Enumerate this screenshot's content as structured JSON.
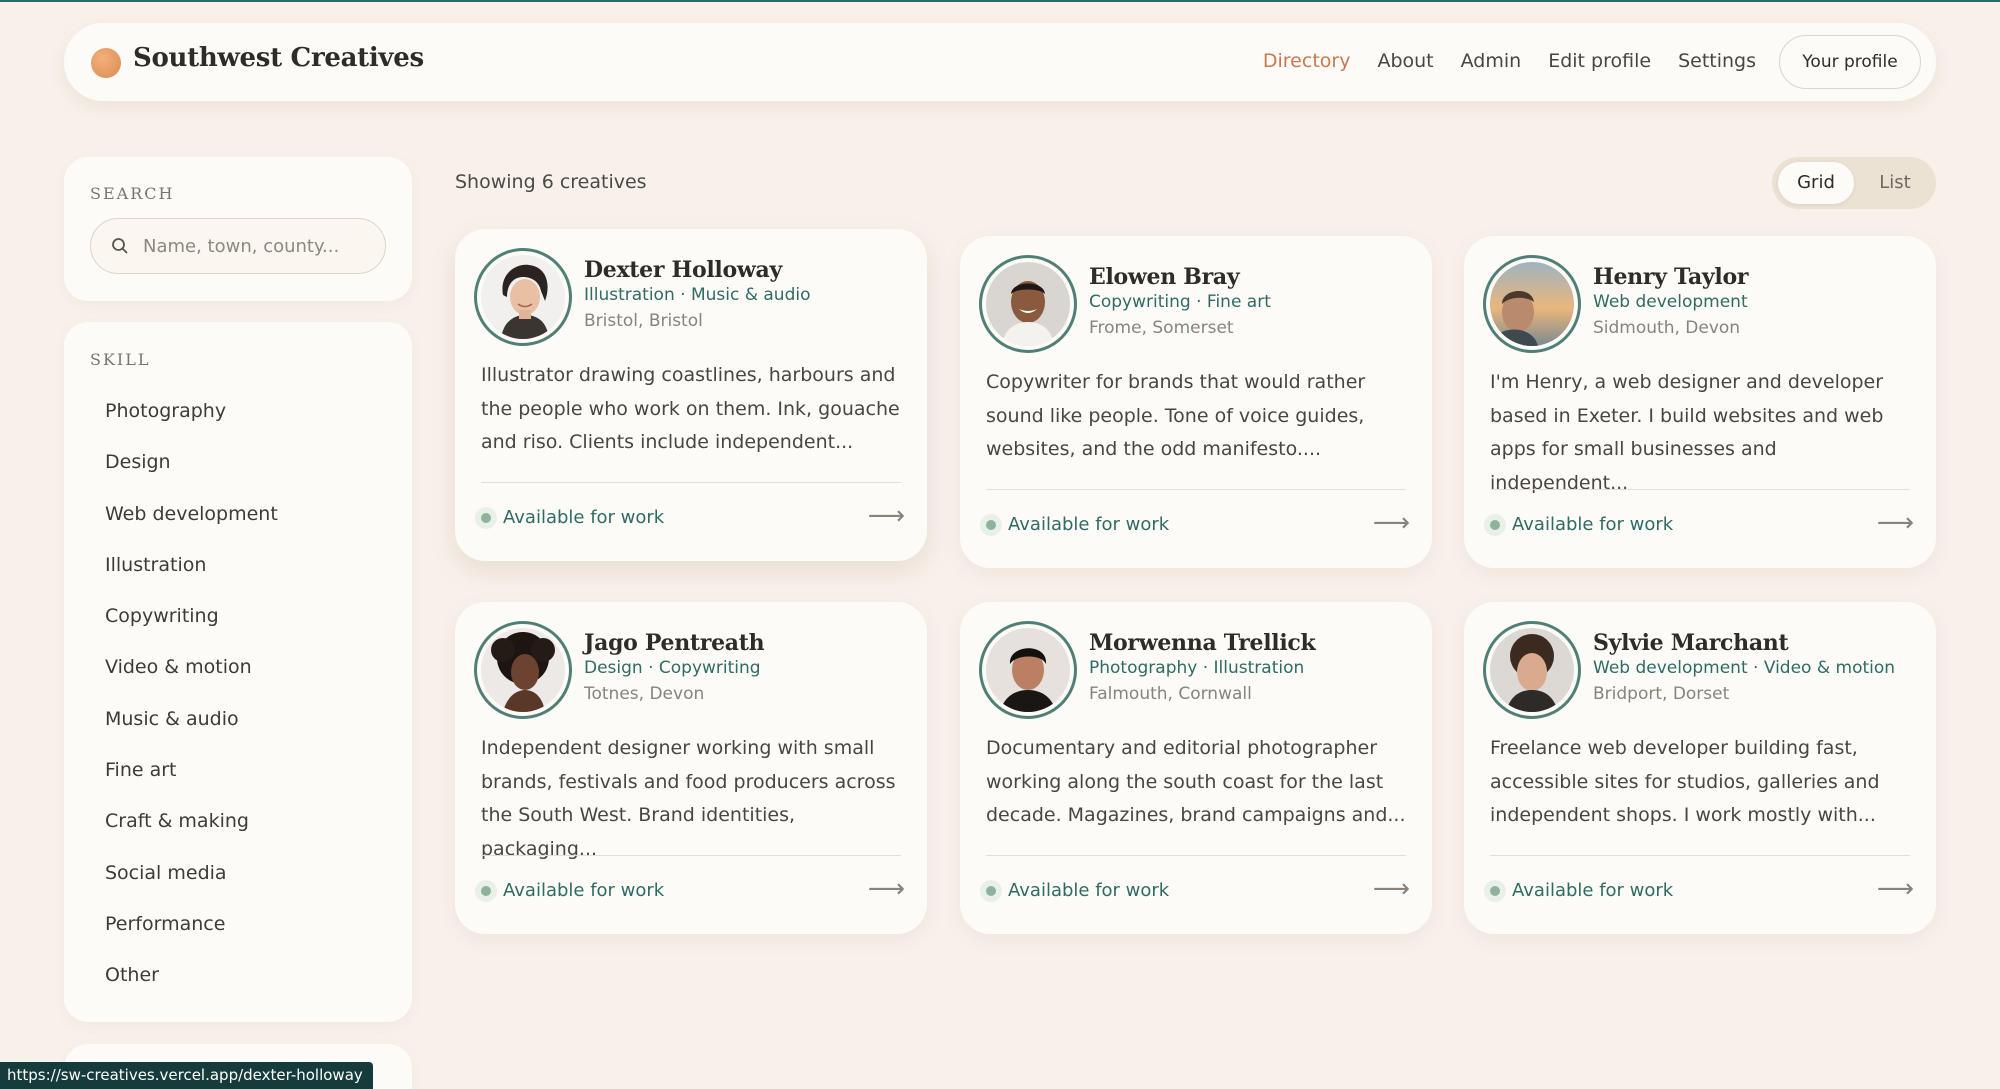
{
  "app": {
    "brand": "Southwest Creatives",
    "accent": "#c9794f",
    "teal": "#2f6b64"
  },
  "nav": {
    "items": [
      "Directory",
      "About",
      "Admin",
      "Edit profile",
      "Settings"
    ],
    "active": "Directory",
    "profile_button": "Your profile"
  },
  "search": {
    "title": "SEARCH",
    "placeholder": "Name, town, county..."
  },
  "skill_filter": {
    "title": "SKILL",
    "items": [
      "Photography",
      "Design",
      "Web development",
      "Illustration",
      "Copywriting",
      "Video & motion",
      "Music & audio",
      "Fine art",
      "Craft & making",
      "Social media",
      "Performance",
      "Other"
    ]
  },
  "results": {
    "count_label": "Showing 6 creatives",
    "view_toggle": {
      "grid": "Grid",
      "list": "List",
      "selected": "Grid"
    }
  },
  "creatives": [
    {
      "name": "Dexter Holloway",
      "skills": "Illustration · Music & audio",
      "location": "Bristol, Bristol",
      "bio": "Illustrator drawing coastlines, harbours and the people who work on them. Ink, gouache and riso. Clients include independent...",
      "status": "Available for work",
      "avatar": "woman-smiling-portrait"
    },
    {
      "name": "Elowen Bray",
      "skills": "Copywriting · Fine art",
      "location": "Frome, Somerset",
      "bio": "Copywriter for brands that would rather sound like people. Tone of voice guides, websites, and the odd manifesto....",
      "status": "Available for work",
      "avatar": "man-smiling-portrait"
    },
    {
      "name": "Henry Taylor",
      "skills": "Web development",
      "location": "Sidmouth, Devon",
      "bio": "I'm Henry, a web designer and developer based in Exeter. I build websites and web apps for small businesses and independent...",
      "status": "Available for work",
      "avatar": "man-sunset-portrait"
    },
    {
      "name": "Jago Pentreath",
      "skills": "Design · Copywriting",
      "location": "Totnes, Devon",
      "bio": "Independent designer working with small brands, festivals and food producers across the South West. Brand identities, packaging...",
      "status": "Available for work",
      "avatar": "woman-curly-hair-portrait"
    },
    {
      "name": "Morwenna Trellick",
      "skills": "Photography · Illustration",
      "location": "Falmouth, Cornwall",
      "bio": "Documentary and editorial photographer working along the south coast for the last decade. Magazines, brand campaigns and...",
      "status": "Available for work",
      "avatar": "young-man-portrait"
    },
    {
      "name": "Sylvie Marchant",
      "skills": "Web development · Video & motion",
      "location": "Bridport, Dorset",
      "bio": "Freelance web developer building fast, accessible sites for studios, galleries and independent shops. I work mostly with...",
      "status": "Available for work",
      "avatar": "curly-hair-man-portrait"
    }
  ],
  "status_bar": {
    "url": "https://sw-creatives.vercel.app/dexter-holloway"
  }
}
